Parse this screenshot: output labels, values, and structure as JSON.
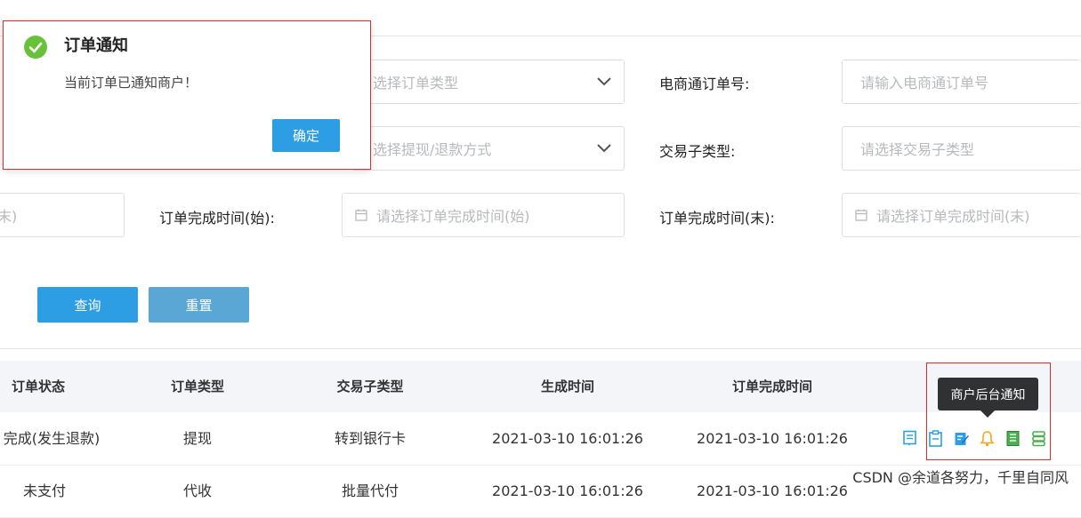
{
  "dialog": {
    "title": "订单通知",
    "message": "当前订单已通知商户！",
    "confirm_label": "确定",
    "success_color": "#67c23a"
  },
  "filters": {
    "order_type_placeholder": "选择订单类型",
    "ecommerce_order_label": "电商通订单号:",
    "ecommerce_order_placeholder": "请输入电商通订单号",
    "withdraw_method_placeholder": "选择提现/退款方式",
    "trade_subtype_label": "交易子类型:",
    "trade_subtype_placeholder": "请选择交易子类型",
    "partial_left_text": "末)",
    "complete_start_label": "订单完成时间(始):",
    "complete_start_placeholder": "请选择订单完成时间(始)",
    "complete_end_label": "订单完成时间(末):",
    "complete_end_placeholder": "请选择订单完成时间(末)"
  },
  "actions": {
    "query_label": "查询",
    "reset_label": "重置",
    "query_color": "#2d9ee3",
    "reset_color": "#5aa7d6"
  },
  "table": {
    "headers": [
      "订单状态",
      "订单类型",
      "交易子类型",
      "生成时间",
      "订单完成时间"
    ],
    "rows": [
      [
        "完成(发生退款)",
        "提现",
        "转到银行卡",
        "2021-03-10 16:01:26",
        "2021-03-10 16:01:26"
      ],
      [
        "未支付",
        "代收",
        "批量代付",
        "2021-03-10 16:01:26",
        "2021-03-10 16:01:26"
      ]
    ],
    "row_action_icons": [
      "detail-icon",
      "clipboard-icon",
      "edit-icon",
      "bell-icon",
      "ledger-icon",
      "stack-icon"
    ]
  },
  "tooltip": {
    "text": "商户后台通知"
  },
  "watermark": "CSDN @余道各努力，千里自同风"
}
